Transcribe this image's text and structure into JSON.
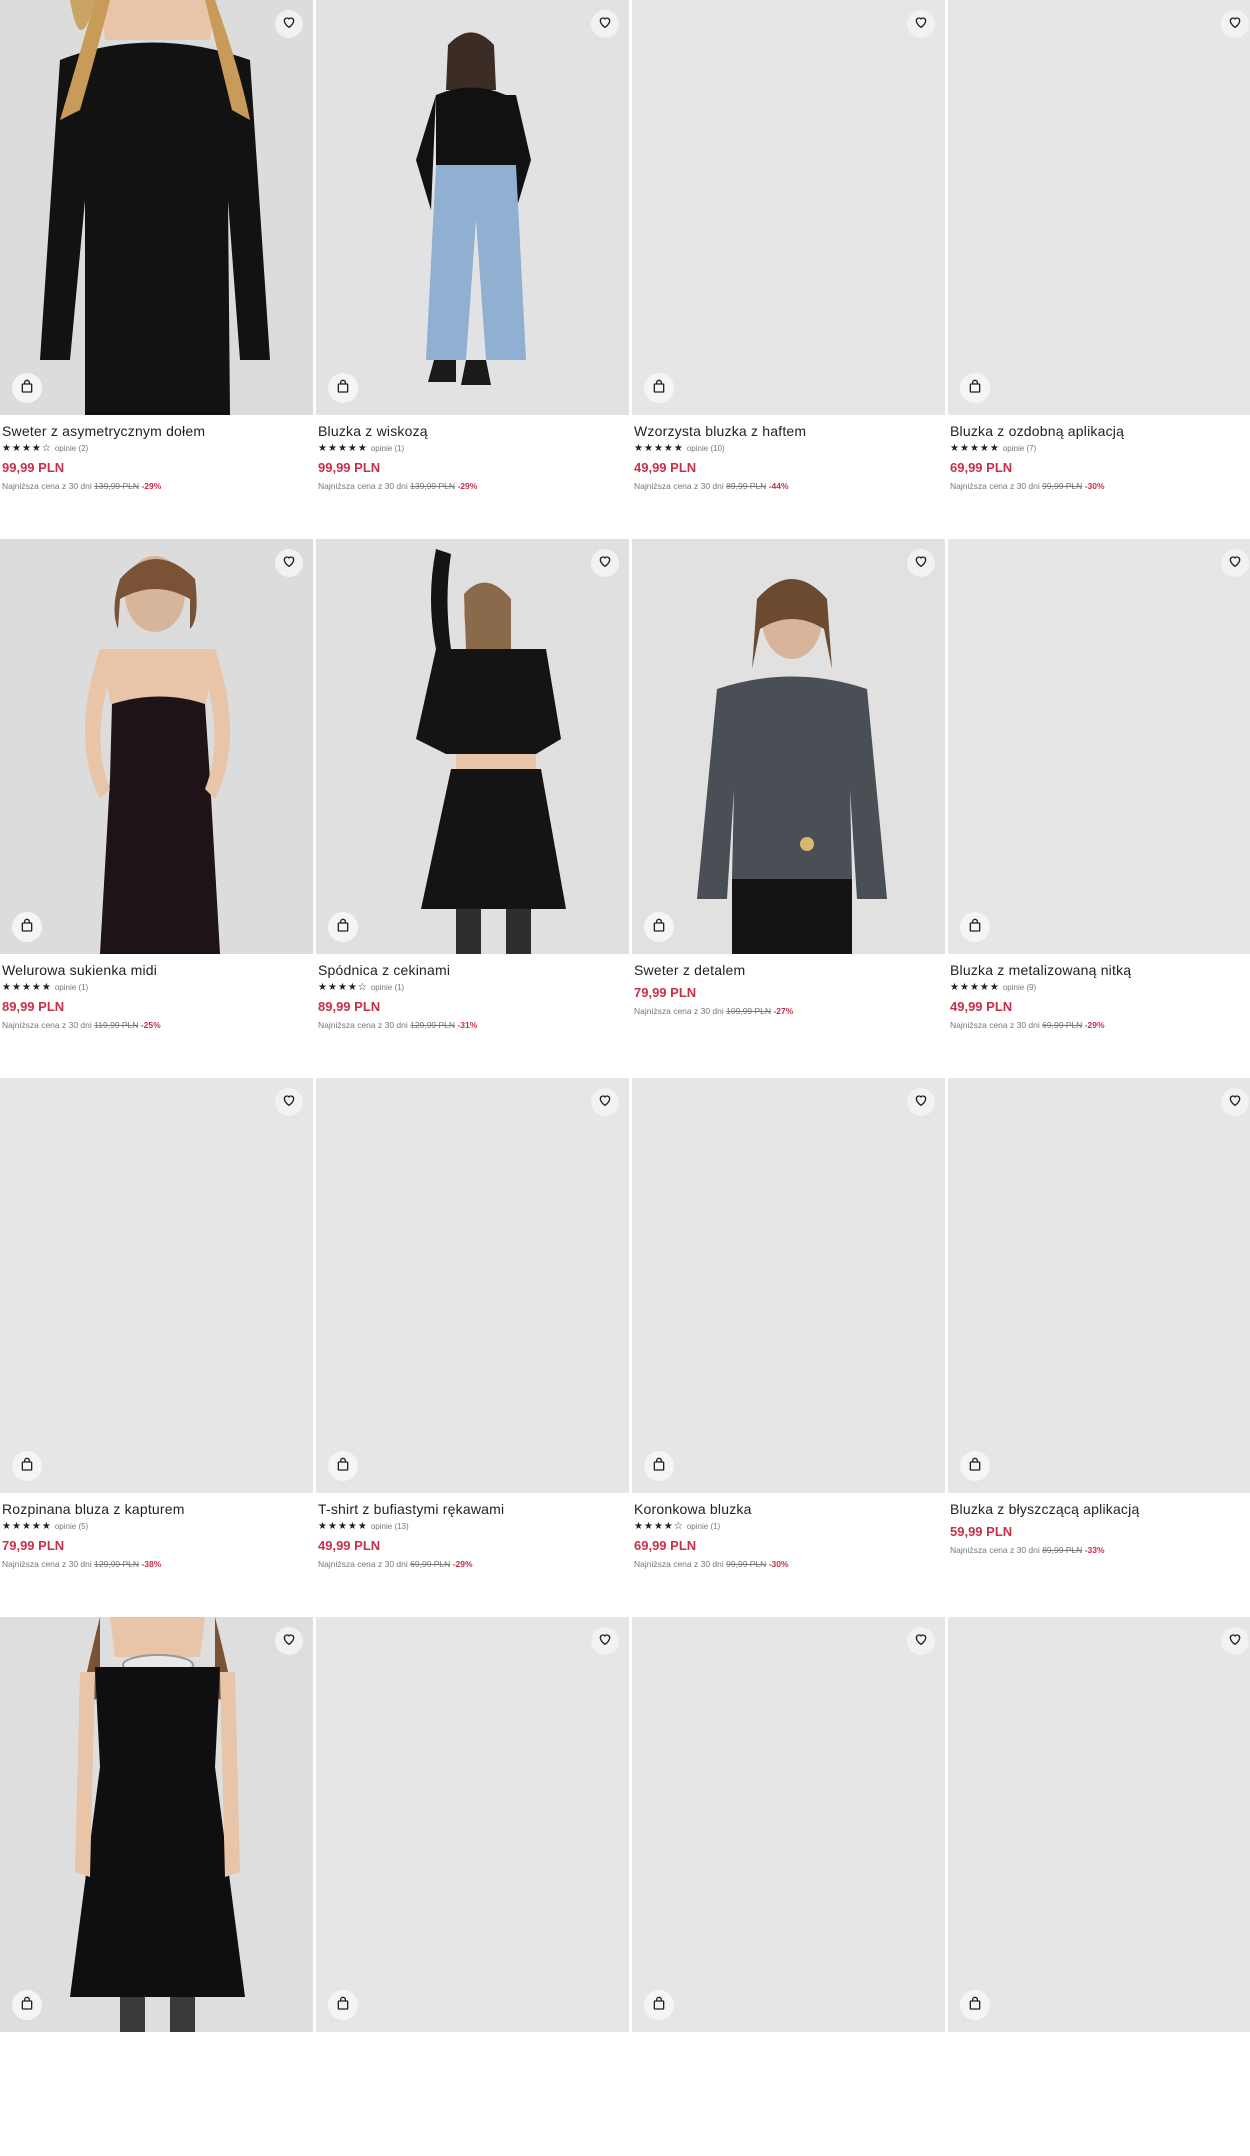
{
  "labels": {
    "lowest_prefix": "Najniższa cena z 30 dni",
    "reviews_prefix": "opinie"
  },
  "colors": {
    "price": "#c8304a",
    "placeholder": "#e8e8e8"
  },
  "icons": {
    "favorite": "heart-icon",
    "cart": "shopping-bag-icon",
    "rating": "star-icon"
  },
  "products": [
    {
      "name": "Sweter z asymetrycznym dołem",
      "rating": 4,
      "reviews": "(2)",
      "price": "99,99 PLN",
      "old_price": "139,99 PLN",
      "discount": "-29%",
      "image": "black-sweater"
    },
    {
      "name": "Bluzka z wiskozą",
      "rating": 5,
      "reviews": "(1)",
      "price": "99,99 PLN",
      "old_price": "139,99 PLN",
      "discount": "-29%",
      "image": "black-cardigan-jeans"
    },
    {
      "name": "Wzorzysta bluzka z haftem",
      "rating": 5,
      "reviews": "(10)",
      "price": "49,99 PLN",
      "old_price": "89,99 PLN",
      "discount": "-44%",
      "image": "placeholder"
    },
    {
      "name": "Bluzka z ozdobną aplikacją",
      "rating": 4.5,
      "reviews": "(7)",
      "price": "69,99 PLN",
      "old_price": "99,99 PLN",
      "discount": "-30%",
      "image": "placeholder"
    },
    {
      "name": "Welurowa sukienka midi",
      "rating": 5,
      "reviews": "(1)",
      "price": "89,99 PLN",
      "old_price": "119,99 PLN",
      "discount": "-25%",
      "image": "velvet-dress"
    },
    {
      "name": "Spódnica z cekinami",
      "rating": 4,
      "reviews": "(1)",
      "price": "89,99 PLN",
      "old_price": "129,99 PLN",
      "discount": "-31%",
      "image": "black-skirt"
    },
    {
      "name": "Sweter z detalem",
      "rating": null,
      "reviews": null,
      "price": "79,99 PLN",
      "old_price": "109,99 PLN",
      "discount": "-27%",
      "image": "grey-sweater"
    },
    {
      "name": "Bluzka z metalizowaną nitką",
      "rating": 4.5,
      "reviews": "(9)",
      "price": "49,99 PLN",
      "old_price": "69,99 PLN",
      "discount": "-29%",
      "image": "placeholder"
    },
    {
      "name": "Rozpinana bluza z kapturem",
      "rating": 5,
      "reviews": "(5)",
      "price": "79,99 PLN",
      "old_price": "129,99 PLN",
      "discount": "-38%",
      "image": "placeholder"
    },
    {
      "name": "T-shirt z bufiastymi rękawami",
      "rating": 5,
      "reviews": "(13)",
      "price": "49,99 PLN",
      "old_price": "69,99 PLN",
      "discount": "-29%",
      "image": "placeholder"
    },
    {
      "name": "Koronkowa bluzka",
      "rating": 4,
      "reviews": "(1)",
      "price": "69,99 PLN",
      "old_price": "99,99 PLN",
      "discount": "-30%",
      "image": "placeholder"
    },
    {
      "name": "Bluzka z błyszczącą aplikacją",
      "rating": null,
      "reviews": null,
      "price": "59,99 PLN",
      "old_price": "89,99 PLN",
      "discount": "-33%",
      "image": "placeholder"
    },
    {
      "name": "",
      "rating": null,
      "reviews": null,
      "price": "",
      "old_price": "",
      "discount": "",
      "image": "black-dress-collar"
    },
    {
      "name": "",
      "rating": null,
      "reviews": null,
      "price": "",
      "old_price": "",
      "discount": "",
      "image": "placeholder"
    },
    {
      "name": "",
      "rating": null,
      "reviews": null,
      "price": "",
      "old_price": "",
      "discount": "",
      "image": "placeholder"
    },
    {
      "name": "",
      "rating": null,
      "reviews": null,
      "price": "",
      "old_price": "",
      "discount": "",
      "image": "placeholder"
    }
  ]
}
